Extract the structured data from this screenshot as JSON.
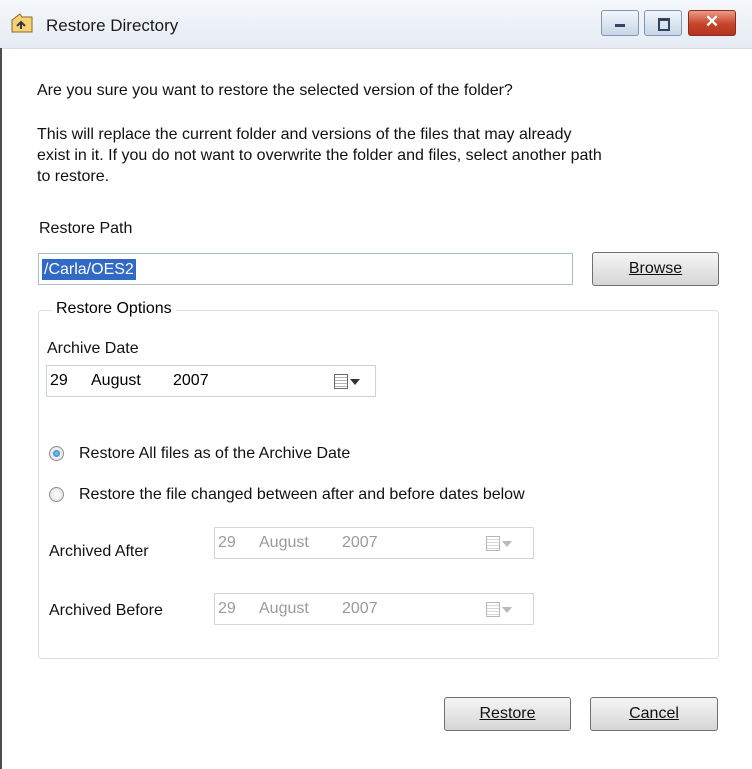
{
  "window": {
    "title": "Restore Directory"
  },
  "message": {
    "question": "Are you sure you want to restore the selected version of the folder?",
    "line1": "This will replace the current folder and versions of the files that may already",
    "line2": "exist in it. If you do not want to overwrite the folder and files, select another path",
    "line3": "to restore."
  },
  "restore_path": {
    "label": "Restore Path",
    "value": "/Carla/OES2"
  },
  "buttons": {
    "browse": "Browse",
    "restore": "Restore",
    "cancel": "Cancel"
  },
  "options": {
    "title": "Restore  Options",
    "archive_date_label": "Archive Date",
    "archive_date": {
      "day": "29",
      "month": "August",
      "year": "2007"
    },
    "radio_all": {
      "label": "Restore All files as of the Archive Date",
      "selected": true
    },
    "radio_changed": {
      "label": "Restore the file changed between after and before dates below",
      "selected": false
    },
    "archived_after": {
      "label": "Archived After",
      "day": "29",
      "month": "August",
      "year": "2007"
    },
    "archived_before": {
      "label": "Archived Before",
      "day": "29",
      "month": "August",
      "year": "2007"
    }
  },
  "icons": [
    "folder-restore-icon",
    "minimize-icon",
    "maximize-icon",
    "close-icon",
    "calendar-icon",
    "dropdown-arrow-icon"
  ]
}
